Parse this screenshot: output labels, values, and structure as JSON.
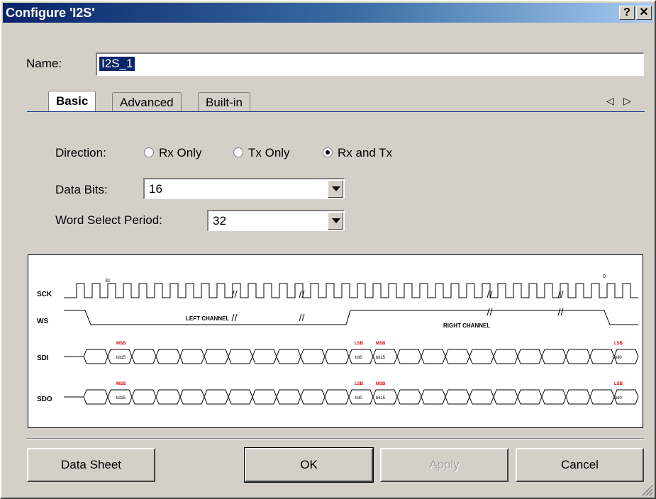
{
  "window": {
    "title": "Configure 'I2S'",
    "help_label": "?",
    "close_label": "✕"
  },
  "name_field": {
    "label": "Name:",
    "value": "I2S_1"
  },
  "tabs": [
    {
      "label": "Basic",
      "active": true
    },
    {
      "label": "Advanced",
      "active": false
    },
    {
      "label": "Built-in",
      "active": false
    }
  ],
  "tab_scroll": {
    "left": "◁",
    "right": "▷"
  },
  "direction": {
    "label": "Direction:",
    "options": [
      {
        "label": "Rx Only",
        "selected": false
      },
      {
        "label": "Tx Only",
        "selected": false
      },
      {
        "label": "Rx and Tx",
        "selected": true
      }
    ]
  },
  "data_bits": {
    "label": "Data Bits:",
    "value": "16"
  },
  "word_select_period": {
    "label": "Word Select Period:",
    "value": "32"
  },
  "timing_diagram": {
    "signals": [
      "SCK",
      "WS",
      "SDI",
      "SDO"
    ],
    "left_channel": "LEFT CHANNEL",
    "right_channel": "RIGHT CHANNEL",
    "sck_markers": [
      "31",
      "0"
    ],
    "msb": "MSB",
    "lsb": "LSB",
    "cells": [
      "bit15",
      "bit0",
      "bit15",
      "bit0"
    ]
  },
  "buttons": {
    "data_sheet": "Data Sheet",
    "ok": "OK",
    "apply": "Apply",
    "cancel": "Cancel"
  }
}
